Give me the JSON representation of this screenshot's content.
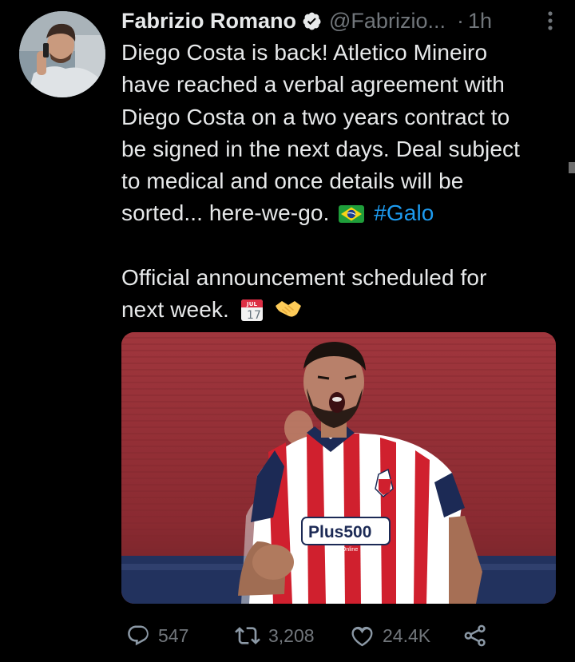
{
  "author": {
    "name": "Fabrizio Romano",
    "handle": "@Fabrizio...",
    "time_separator": "·",
    "time": "1h"
  },
  "tweet": {
    "lines": [
      "Diego Costa is back! Atletico Mineiro",
      "have reached a verbal agreement with",
      "Diego Costa on a two years contract to",
      "be signed in the next days. Deal subject",
      "to medical and once details will be"
    ],
    "line6_text": "sorted... here-we-go.",
    "hashtag": "#Galo",
    "line7": "Official announcement scheduled for",
    "line8_text": "next week.",
    "calendar_month": "JUL",
    "calendar_day": "17"
  },
  "media": {
    "sponsor_text": "Plus500",
    "sponsor_subtext": "Trade Online"
  },
  "actions": {
    "replies": "547",
    "retweets": "3,208",
    "likes": "24.4K"
  },
  "icons": {
    "verified": "verified-badge-icon",
    "more": "more-icon",
    "reply": "reply-icon",
    "retweet": "retweet-icon",
    "like": "heart-icon",
    "share": "share-icon",
    "flag": "brazil-flag-icon",
    "calendar": "calendar-icon",
    "handshake": "handshake-icon"
  },
  "colors": {
    "background": "#000000",
    "text": "#e7e9ea",
    "secondary": "#71767b",
    "link": "#1d9bf0"
  }
}
